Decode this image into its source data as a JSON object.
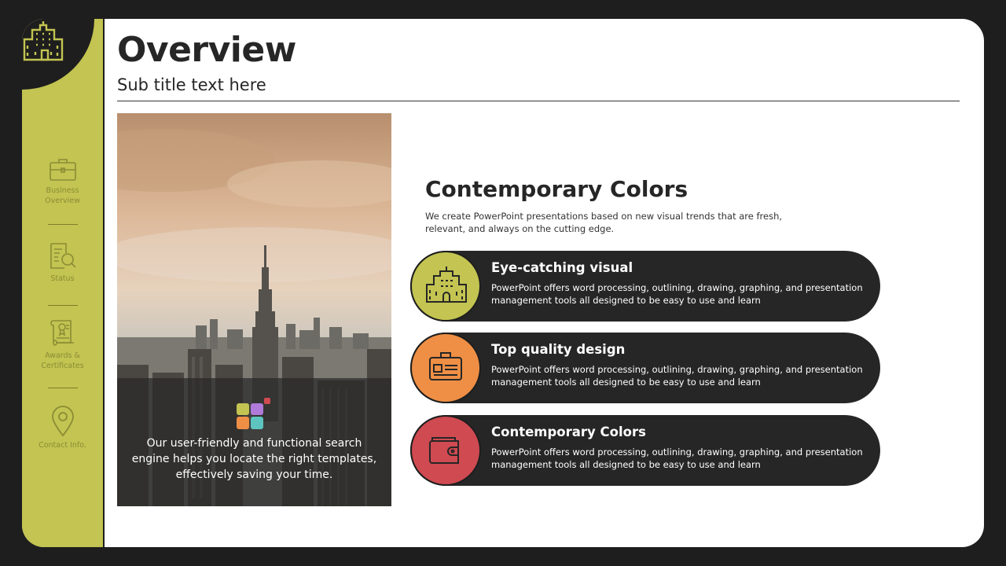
{
  "header": {
    "title": "Overview",
    "subtitle": "Sub title text here"
  },
  "sidebar": {
    "items": [
      {
        "label": "Business\nOverview",
        "icon": "briefcase-icon"
      },
      {
        "label": "Status",
        "icon": "document-search-icon"
      },
      {
        "label": "Awards &\nCertificates",
        "icon": "certificate-icon"
      },
      {
        "label": "Contact Info.",
        "icon": "location-pin-icon"
      }
    ]
  },
  "photo": {
    "caption": "Our user-friendly and functional search engine helps you locate the right templates, effectively saving your time."
  },
  "section": {
    "title": "Contemporary Colors",
    "description": "We create PowerPoint  presentations  based on new visual  trends that are fresh, relevant, and always  on the cutting edge."
  },
  "features": [
    {
      "title": "Eye-catching visual",
      "description": "PowerPoint  offers word processing, outlining, drawing, graphing, and presentation management tools all designed to be easy to use and learn",
      "icon": "building-icon",
      "color": "#c3c451"
    },
    {
      "title": "Top quality design",
      "description": "PowerPoint  offers word processing, outlining, drawing, graphing, and presentation management tools all designed to be easy to use and learn",
      "icon": "id-card-icon",
      "color": "#ee8f45"
    },
    {
      "title": "Contemporary Colors",
      "description": "PowerPoint  offers word processing, outlining, drawing, graphing, and presentation management tools all designed to be easy to use and learn",
      "icon": "wallet-icon",
      "color": "#d04a51"
    }
  ],
  "colors": {
    "accent": "#c3c451",
    "background": "#1e1e1e",
    "card": "#262626"
  }
}
